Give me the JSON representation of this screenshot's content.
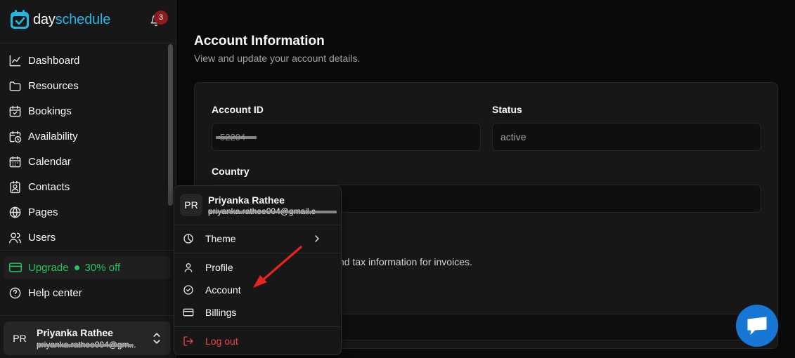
{
  "brand": {
    "prefix": "day",
    "suffix": "schedule",
    "accent": "#22b8e6"
  },
  "notifications": {
    "icon": "bell-icon",
    "count": "3"
  },
  "sidebar": {
    "items": [
      {
        "label": "Dashboard",
        "icon": "chart-line-icon"
      },
      {
        "label": "Resources",
        "icon": "folder-icon"
      },
      {
        "label": "Bookings",
        "icon": "calendar-check-icon"
      },
      {
        "label": "Availability",
        "icon": "calendar-clock-icon"
      },
      {
        "label": "Calendar",
        "icon": "calendar-icon"
      },
      {
        "label": "Contacts",
        "icon": "contact-icon"
      },
      {
        "label": "Pages",
        "icon": "globe-icon"
      },
      {
        "label": "Users",
        "icon": "users-icon"
      }
    ],
    "upgrade": {
      "label": "Upgrade",
      "discount": "30% off",
      "color": "#22c55e"
    },
    "help": {
      "label": "Help center",
      "icon": "help-circle-icon"
    }
  },
  "user": {
    "initials": "PR",
    "name": "Priyanka Rathee",
    "email": "priyanka.rathee004@gm..."
  },
  "main": {
    "title": "Account Information",
    "subtitle": "View and update your account details.",
    "account_id_label": "Account ID",
    "account_id_value": "52204",
    "status_label": "Status",
    "status_value": "active",
    "country_label": "Country",
    "billing_hint": "nd tax information for invoices."
  },
  "menu": {
    "email": "priyanka.rathee004@gmail.c",
    "theme_label": "Theme",
    "profile_label": "Profile",
    "account_label": "Account",
    "billings_label": "Billings",
    "logout_label": "Log out",
    "danger_color": "#ef4444"
  }
}
